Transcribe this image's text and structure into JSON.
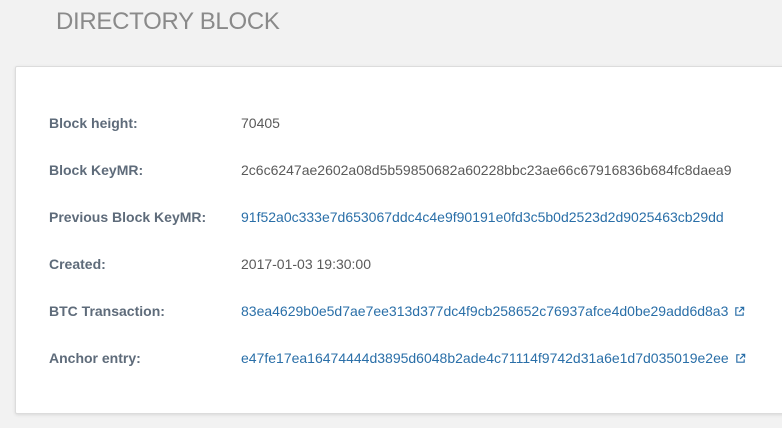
{
  "page": {
    "title": "DIRECTORY BLOCK"
  },
  "details": [
    {
      "label": "Block height:",
      "value": "70405",
      "type": "text"
    },
    {
      "label": "Block KeyMR:",
      "value": "2c6c6247ae2602a08d5b59850682a60228bbc23ae66c67916836b684fc8daea9",
      "type": "text"
    },
    {
      "label": "Previous Block KeyMR:",
      "value": "91f52a0c333e7d653067ddc4c4e9f90191e0fd3c5b0d2523d2d9025463cb29dd",
      "type": "link"
    },
    {
      "label": "Created:",
      "value": "2017-01-03 19:30:00",
      "type": "text"
    },
    {
      "label": "BTC Transaction:",
      "value": "83ea4629b0e5d7ae7ee313d377dc4f9cb258652c76937afce4d0be29add6d8a3",
      "type": "external-link",
      "icon": "external-link-icon"
    },
    {
      "label": "Anchor entry:",
      "value": "e47fe17ea16474444d3895d6048b2ade4c71114f9742d31a6e1d7d035019e2ee",
      "type": "external-link",
      "icon": "external-link-icon"
    }
  ],
  "colors": {
    "background": "#f2f2f2",
    "title": "#8a8a8a",
    "label": "#5e6b7a",
    "text_value": "#5a5a5a",
    "link": "#2a6fa8"
  }
}
